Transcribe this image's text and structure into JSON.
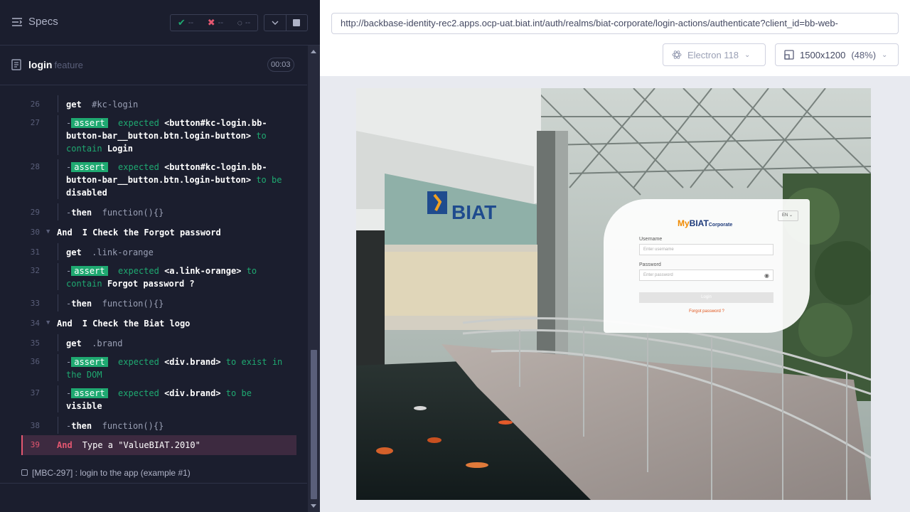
{
  "reporter": {
    "specs_label": "Specs",
    "stats": {
      "passed": "--",
      "failed": "--",
      "pending": "--"
    },
    "file": {
      "name": "login",
      "type": "feature",
      "duration": "00:03"
    },
    "commands": [
      {
        "num": "26",
        "kind": "cmd",
        "name": "get",
        "message": "#kc-login"
      },
      {
        "num": "27",
        "kind": "assert",
        "badge": "assert",
        "pre": "expected",
        "subject": "<button#kc-login.bb-button-bar__button.btn.login-button>",
        "mid": "to contain",
        "value": "Login"
      },
      {
        "num": "28",
        "kind": "assert",
        "badge": "assert",
        "pre": "expected",
        "subject": "<button#kc-login.bb-button-bar__button.btn.login-button>",
        "mid": "to be",
        "value": "disabled"
      },
      {
        "num": "29",
        "kind": "cmd",
        "name": "then",
        "message": "function(){}"
      },
      {
        "num": "30",
        "kind": "step",
        "keyword": "And",
        "text": "I Check the Forgot password"
      },
      {
        "num": "31",
        "kind": "cmd",
        "name": "get",
        "message": ".link-orange"
      },
      {
        "num": "32",
        "kind": "assert",
        "badge": "assert",
        "pre": "expected",
        "subject": "<a.link-orange>",
        "mid": "to contain",
        "value": "Forgot password ?"
      },
      {
        "num": "33",
        "kind": "cmd",
        "name": "then",
        "message": "function(){}"
      },
      {
        "num": "34",
        "kind": "step",
        "keyword": "And",
        "text": "I Check the Biat logo"
      },
      {
        "num": "35",
        "kind": "cmd",
        "name": "get",
        "message": ".brand"
      },
      {
        "num": "36",
        "kind": "assert",
        "badge": "assert",
        "pre": "expected",
        "subject": "<div.brand>",
        "mid": "to exist in the DOM",
        "value": ""
      },
      {
        "num": "37",
        "kind": "assert",
        "badge": "assert",
        "pre": "expected",
        "subject": "<div.brand>",
        "mid": "to be",
        "value": "visible"
      },
      {
        "num": "38",
        "kind": "cmd",
        "name": "then",
        "message": "function(){}"
      },
      {
        "num": "39",
        "kind": "active",
        "keyword": "And",
        "text": "Type a \"ValueBIAT.2010\""
      }
    ],
    "test_title": "[MBC-297] : login to the app (example #1)"
  },
  "aut": {
    "url": "http://backbase-identity-rec2.apps.ocp-uat.biat.int/auth/realms/biat-corporate/login-actions/authenticate?client_id=bb-web-",
    "browser": "Electron 118",
    "viewport": "1500x1200",
    "zoom": "(48%)",
    "page": {
      "lang": "EN",
      "logo_my": "My",
      "logo_biat": "BIAT",
      "logo_corp": "Corporate",
      "building_sign": "BIAT",
      "username_label": "Username",
      "username_placeholder": "Enter username",
      "password_label": "Password",
      "password_placeholder": "Enter password",
      "login_button": "Login",
      "forgot_link": "Forgot password ?"
    }
  },
  "colors": {
    "pass": "#1fa971",
    "fail": "#e45770",
    "bg": "#1b1e2e"
  }
}
